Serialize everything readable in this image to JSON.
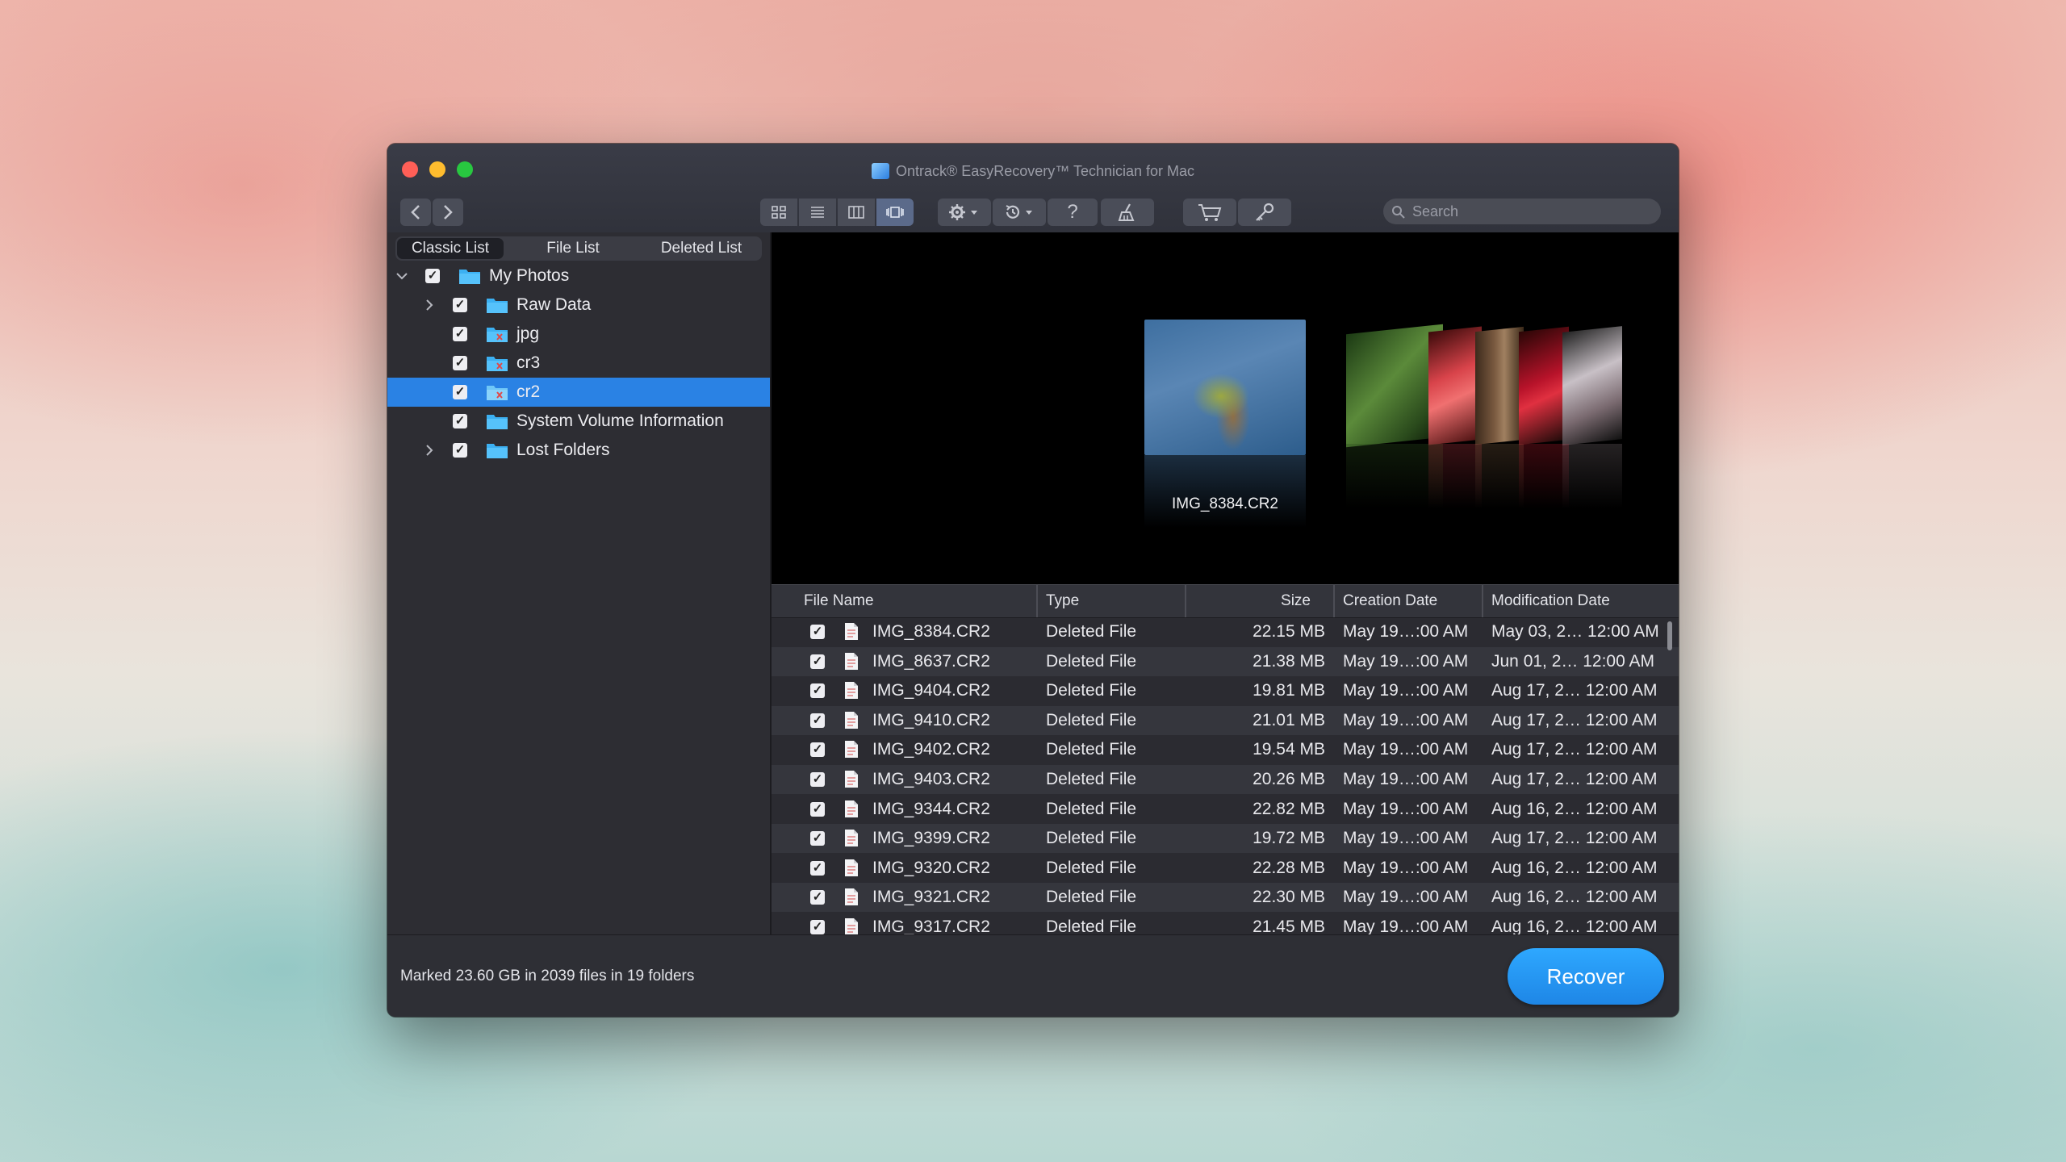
{
  "window": {
    "title": "Ontrack® EasyRecovery™ Technician for Mac"
  },
  "toolbar": {
    "search_placeholder": "Search",
    "buttons": [
      "back",
      "forward",
      "icon-view",
      "list-view",
      "column-view",
      "coverflow-view",
      "settings",
      "history",
      "help",
      "clean",
      "cart",
      "key"
    ]
  },
  "tabs": {
    "classic": "Classic List",
    "file": "File List",
    "deleted": "Deleted List"
  },
  "tree": [
    {
      "label": "My Photos",
      "expanded": true
    },
    {
      "label": "Raw Data",
      "expandable": true
    },
    {
      "label": "jpg"
    },
    {
      "label": "cr3"
    },
    {
      "label": "cr2",
      "selected": true
    },
    {
      "label": "System Volume Information"
    },
    {
      "label": "Lost Folders",
      "expandable": true
    }
  ],
  "preview": {
    "caption": "IMG_8384.CR2"
  },
  "columns": {
    "name": "File Name",
    "type": "Type",
    "size": "Size",
    "created": "Creation Date",
    "modified": "Modification Date"
  },
  "files": [
    {
      "name": "IMG_8384.CR2",
      "type": "Deleted File",
      "size": "22.15 MB",
      "created": "May 19…:00 AM",
      "modified": "May 03, 2… 12:00 AM"
    },
    {
      "name": "IMG_8637.CR2",
      "type": "Deleted File",
      "size": "21.38 MB",
      "created": "May 19…:00 AM",
      "modified": "Jun 01, 2… 12:00 AM"
    },
    {
      "name": "IMG_9404.CR2",
      "type": "Deleted File",
      "size": "19.81 MB",
      "created": "May 19…:00 AM",
      "modified": "Aug 17, 2… 12:00 AM"
    },
    {
      "name": "IMG_9410.CR2",
      "type": "Deleted File",
      "size": "21.01 MB",
      "created": "May 19…:00 AM",
      "modified": "Aug 17, 2… 12:00 AM"
    },
    {
      "name": "IMG_9402.CR2",
      "type": "Deleted File",
      "size": "19.54 MB",
      "created": "May 19…:00 AM",
      "modified": "Aug 17, 2… 12:00 AM"
    },
    {
      "name": "IMG_9403.CR2",
      "type": "Deleted File",
      "size": "20.26 MB",
      "created": "May 19…:00 AM",
      "modified": "Aug 17, 2… 12:00 AM"
    },
    {
      "name": "IMG_9344.CR2",
      "type": "Deleted File",
      "size": "22.82 MB",
      "created": "May 19…:00 AM",
      "modified": "Aug 16, 2… 12:00 AM"
    },
    {
      "name": "IMG_9399.CR2",
      "type": "Deleted File",
      "size": "19.72 MB",
      "created": "May 19…:00 AM",
      "modified": "Aug 17, 2… 12:00 AM"
    },
    {
      "name": "IMG_9320.CR2",
      "type": "Deleted File",
      "size": "22.28 MB",
      "created": "May 19…:00 AM",
      "modified": "Aug 16, 2… 12:00 AM"
    },
    {
      "name": "IMG_9321.CR2",
      "type": "Deleted File",
      "size": "22.30 MB",
      "created": "May 19…:00 AM",
      "modified": "Aug 16, 2… 12:00 AM"
    },
    {
      "name": "IMG_9317.CR2",
      "type": "Deleted File",
      "size": "21.45 MB",
      "created": "May 19…:00 AM",
      "modified": "Aug 16, 2… 12:00 AM"
    }
  ],
  "status": "Marked 23.60 GB in 2039 files in 19 folders",
  "recover_label": "Recover",
  "colors": {
    "accent": "#2a82e4",
    "recover": "#1e90ff",
    "close": "#ff5f57",
    "minimize": "#febc2e",
    "zoom": "#28c840"
  }
}
